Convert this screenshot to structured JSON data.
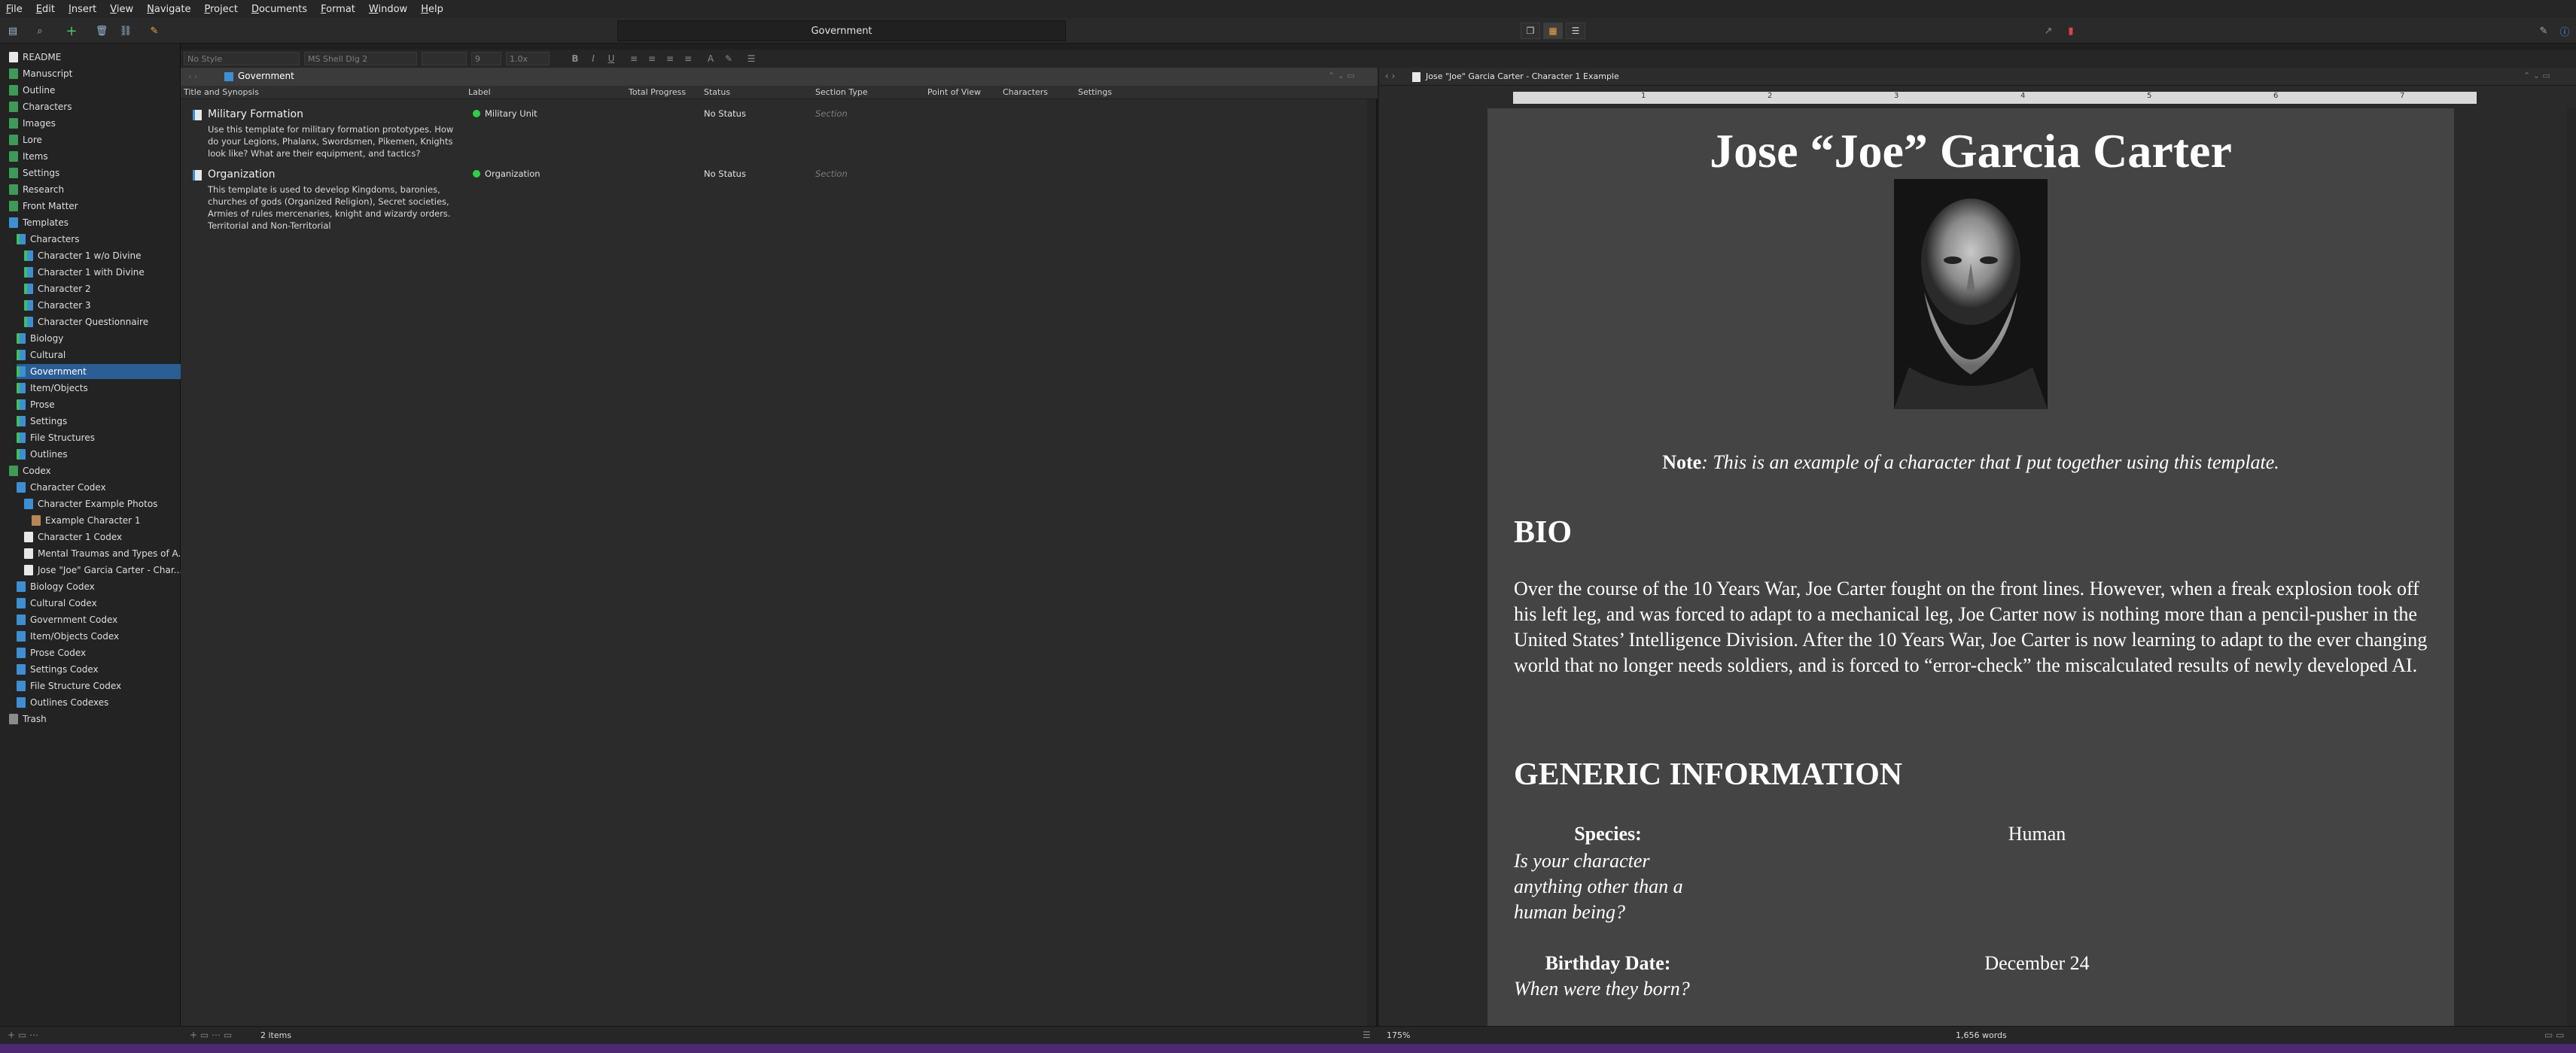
{
  "menu": [
    "File",
    "Edit",
    "Insert",
    "View",
    "Navigate",
    "Project",
    "Documents",
    "Format",
    "Window",
    "Help"
  ],
  "toolbar": {
    "document_title": "Government"
  },
  "formatbar": {
    "style": "No Style",
    "font": "MS Shell Dlg 2",
    "size": "9",
    "spacing": "1.0x"
  },
  "binder": {
    "items": [
      {
        "label": "README",
        "icon": "doc"
      },
      {
        "label": "Manuscript",
        "icon": "green"
      },
      {
        "label": "Outline",
        "icon": "green"
      },
      {
        "label": "Characters",
        "icon": "green"
      },
      {
        "label": "Images",
        "icon": "green"
      },
      {
        "label": "Lore",
        "icon": "green"
      },
      {
        "label": "Items",
        "icon": "green"
      },
      {
        "label": "Settings",
        "icon": "green"
      },
      {
        "label": "Research",
        "icon": "green"
      },
      {
        "label": "Front Matter",
        "icon": "green"
      },
      {
        "label": "Templates",
        "icon": "fold"
      },
      {
        "label": "Characters",
        "icon": "chk"
      },
      {
        "label": "Character 1 w/o Divine",
        "icon": "chk"
      },
      {
        "label": "Character 1 with Divine",
        "icon": "chk"
      },
      {
        "label": "Character 2",
        "icon": "chk"
      },
      {
        "label": "Character 3",
        "icon": "chk"
      },
      {
        "label": "Character Questionnaire",
        "icon": "chk"
      },
      {
        "label": "Biology",
        "icon": "chk"
      },
      {
        "label": "Cultural",
        "icon": "chk"
      },
      {
        "label": "Government",
        "icon": "chk"
      },
      {
        "label": "Item/Objects",
        "icon": "chk"
      },
      {
        "label": "Prose",
        "icon": "chk"
      },
      {
        "label": "Settings",
        "icon": "chk"
      },
      {
        "label": "File Structures",
        "icon": "chk"
      },
      {
        "label": "Outlines",
        "icon": "chk"
      },
      {
        "label": "Codex",
        "icon": "green"
      },
      {
        "label": "Character Codex",
        "icon": "fold"
      },
      {
        "label": "Character Example Photos",
        "icon": "fold"
      },
      {
        "label": "Example Character 1",
        "icon": "img"
      },
      {
        "label": "Character 1 Codex",
        "icon": "doc"
      },
      {
        "label": "Mental Traumas and Types of A...",
        "icon": "doc"
      },
      {
        "label": "Jose \"Joe\" Garcia Carter - Char...",
        "icon": "doc"
      },
      {
        "label": "Biology Codex",
        "icon": "fold"
      },
      {
        "label": "Cultural Codex",
        "icon": "fold"
      },
      {
        "label": "Government Codex",
        "icon": "fold"
      },
      {
        "label": "Item/Objects Codex",
        "icon": "fold"
      },
      {
        "label": "Prose Codex",
        "icon": "fold"
      },
      {
        "label": "Settings Codex",
        "icon": "fold"
      },
      {
        "label": "File Structure Codex",
        "icon": "fold"
      },
      {
        "label": "Outlines Codexes",
        "icon": "fold"
      },
      {
        "label": "Trash",
        "icon": "trash"
      }
    ]
  },
  "outliner": {
    "header_title": "Government",
    "columns": [
      "Title and Synopsis",
      "Label",
      "Total Progress",
      "Status",
      "Section Type",
      "Point of View",
      "Characters",
      "Settings"
    ],
    "rows": [
      {
        "title": "Military Formation",
        "synopsis": "Use this template for military formation prototypes. How do your Legions, Phalanx, Swordsmen, Pikemen, Knights look like? What are their equipment, and tactics?",
        "label": "Military Unit",
        "status": "No Status",
        "section_type": "Section"
      },
      {
        "title": "Organization",
        "synopsis": "This template is used to develop Kingdoms, baronies, churches of gods (Organized Religion), Secret societies, Armies of rules mercenaries, knight and wizardy orders. Territorial and Non-Territorial",
        "label": "Organization",
        "status": "No Status",
        "section_type": "Section"
      }
    ],
    "item_count": "2 items"
  },
  "editor": {
    "header_title": "Jose \"Joe\" Garcia Carter - Character 1 Example",
    "ruler_ticks": [
      "1",
      "2",
      "3",
      "4",
      "5",
      "6",
      "7"
    ],
    "doc_title": "Jose “Joe” Garcia Carter",
    "note_label": "Note",
    "note_text": ": This is an example of a character that I put together using this template.",
    "bio_heading": "BIO",
    "bio_text": "Over the course of the 10 Years War, Joe Carter fought on the front lines. However, when a freak explosion took off his left leg, and was forced to adapt to a mechanical leg, Joe Carter now is nothing more than a pencil-pusher in the United States’ Intelligence Division. After the 10 Years War, Joe Carter is now learning to adapt to the ever changing world that no longer needs soldiers, and is forced to  “error-check” the miscalculated results of newly developed AI.",
    "generic_heading": "GENERIC INFORMATION",
    "fields": [
      {
        "label": "Species:",
        "hint": "Is your character anything other than a human being?",
        "value": "Human"
      },
      {
        "label": "Birthday Date:",
        "hint": "When were they born?",
        "value": "December 24"
      }
    ],
    "zoom": "175%",
    "word_count": "1,656 words"
  },
  "colors": {
    "accent": "#2a5e95",
    "status_green": "#2fd046",
    "page_bg": "#444444",
    "bottom_strip": "#4b2a73"
  }
}
